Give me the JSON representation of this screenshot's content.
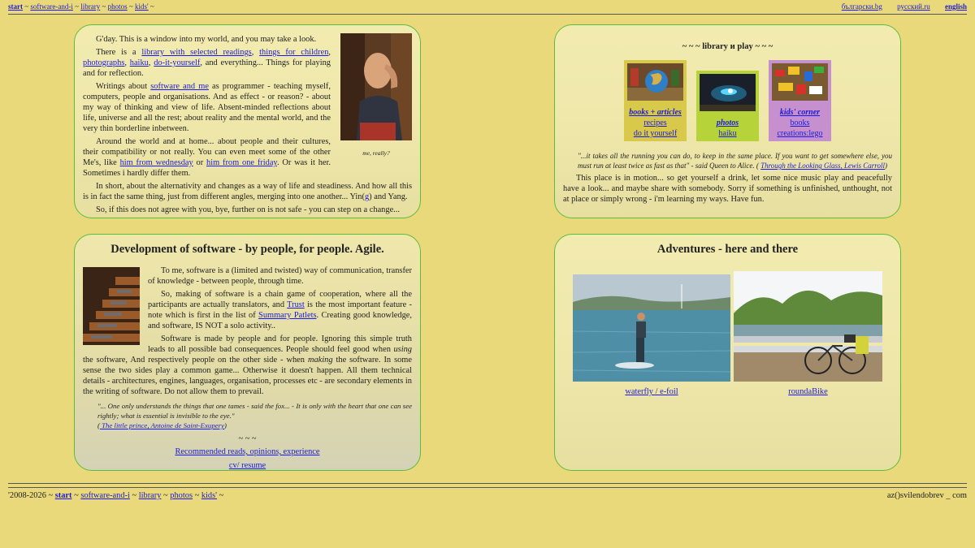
{
  "nav": {
    "start": "start",
    "software": "software-and-i",
    "library": "library",
    "photos": "photos",
    "kids": "kids'",
    "sep": "~",
    "lang_bg": "български.bg",
    "lang_ru": "русский.ru",
    "lang_en": "english"
  },
  "intro": {
    "greeting": "G'day. This is a window into my world, and you may take a look.",
    "portrait_caption": "me, really?",
    "p2_pre": "There is a ",
    "link_library": "library with selected readings",
    "link_children": "things for children",
    "link_photographs": "photographs",
    "link_haiku": "haiku",
    "link_diy": "do-it-yourself",
    "p2_post": ", and everything... Things for playing and for reflection.",
    "p3_pre": "Writings about ",
    "link_software_me": "software and me",
    "p3_post": " as programmer - teaching myself, computers, people and organisations. And as effect - or reason? - about my way of thinking and view of life. Absent-minded reflections about life, universe and all the rest; about reality and the mental world, and the very thin borderline inbetween.",
    "p4_pre": "Around the world and at home... about people and their cultures, their compatibility or not really. You can even meet some of the other Me's, like ",
    "link_wednesday": "him from wednesday",
    "p4_or": " or ",
    "link_friday": "him from one friday",
    "p4_post": ". Or was it her. Sometimes i hardly differ them.",
    "p5_pre": "In short, about the alternativity and changes as a way of life and steadiness. And how all this is in fact the same thing, just from different angles, merging into one another... Yin(",
    "link_g": "g",
    "p5_post": ") and Yang.",
    "p6": "So, if this does not agree with you, bye, further on is not safe - you can step on a change..."
  },
  "library": {
    "heading": "~ ~ ~ library и play ~ ~ ~",
    "tiles": [
      {
        "title": "books + articles",
        "l1": "recipes",
        "l2": "do it yourself"
      },
      {
        "title": "photos",
        "l1": "haiku"
      },
      {
        "title": "kids' corner",
        "l1": "books",
        "l2": "creations:lego"
      }
    ],
    "quote_text": "\"...it takes all the running you can do, to keep in the same place. If you want to get somewhere else, you must run at least twice as fast as that\" - said Queen to Alice. ( ",
    "quote_link": "Through the Looking Glass, Lewis Carroll",
    "quote_end": ")",
    "body": "This place is in motion... so get yourself a drink, let some nice music play and peacefully have a look... and maybe share with somebody. Sorry if something is unfinished, unthought, not at place or simply wrong - i'm learning my ways. Have fun."
  },
  "software": {
    "heading": "Development of software - by people, for people. Agile.",
    "p1": "To me, software is a (limited and twisted) way of communication, transfer of knowledge - between people, through time.",
    "p2_pre": "So, making of software is a chain game of cooperation, where all the participants are actually translators, and ",
    "link_trust": "Trust",
    "p2_mid": " is the most important feature - note which is first in the list of ",
    "link_patlets": "Summary Patlets",
    "p2_post": ". Creating good knowledge, and software, IS NOT a solo activity..",
    "p3_a": "Software is made by people and for people. Ignoring this simple truth leads to all possible bad consequences. People should feel good when ",
    "p3_using": "using",
    "p3_b": " the software, And respectively people on the other side - when ",
    "p3_making": "making",
    "p3_c": " the software. In some sense the two sides play a common game... Otherwise it doesn't happen. All them technical details - architectures, engines, languages, organisation, processes etc - are secondary elements in the writing of software. Do not allow them to prevail.",
    "quote_text": "\"... One only understands the things that one tames - said the fox... - It is only with the heart that one can see rightly; what is essential is invisible to the eye.\"",
    "quote_open": "(",
    "quote_link": " The little prince, Antoine de Saint-Exupery",
    "quote_close": ")",
    "tilde": "~ ~ ~",
    "link_reads": "Recommended reads, opinions, experience",
    "link_cv": "cv/ resume"
  },
  "adventures": {
    "heading": "Adventures - here and there",
    "waterfly": "waterfly / e-foil",
    "roundabike": "roundaBike"
  },
  "footer": {
    "years": "'2008-2026 ~ ",
    "start": "start",
    "software": "software-and-i",
    "library": "library",
    "photos": "photos",
    "kids": "kids'",
    "sep": " ~ ",
    "email": "az()svilendobrev _ com"
  }
}
